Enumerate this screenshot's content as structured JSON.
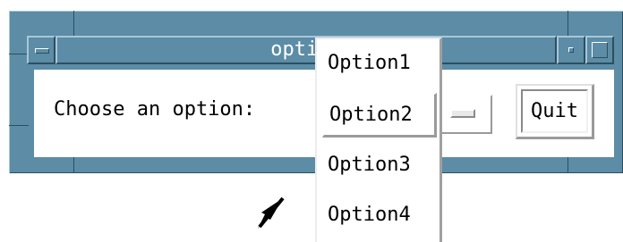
{
  "window": {
    "title": "option",
    "menu_button_icon": "window-menu-icon",
    "minimize_icon": "minimize-icon",
    "maximize_icon": "maximize-icon"
  },
  "form": {
    "prompt_label": "Choose an option:",
    "selected_option": "Option2",
    "cascade_icon": "option-menu-indicator-icon",
    "quit_label": "Quit"
  },
  "popup_menu": {
    "items": [
      {
        "label": "Option1"
      },
      {
        "label": "Option2",
        "selected": true
      },
      {
        "label": "Option3"
      },
      {
        "label": "Option4"
      }
    ]
  },
  "cursor": {
    "icon": "pointer-arrow-icon"
  },
  "colors": {
    "frame": "#5c8ca6",
    "frame_light": "#a9c7d8",
    "frame_dark": "#2b4f62",
    "client_bg": "#ffffff"
  }
}
